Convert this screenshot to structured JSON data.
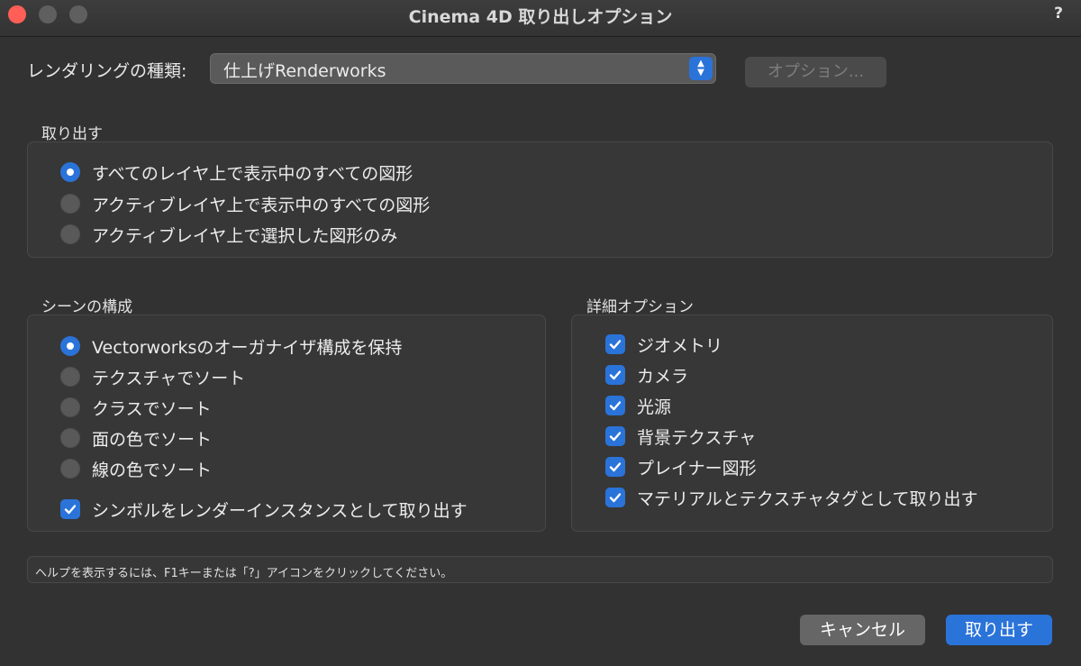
{
  "window": {
    "title": "Cinema 4D 取り出しオプション",
    "help": "?"
  },
  "render": {
    "label": "レンダリングの種類:",
    "selected": "仕上げRenderworks",
    "options_button": "オプション..."
  },
  "export": {
    "title": "取り出す",
    "options": [
      {
        "label": "すべてのレイヤ上で表示中のすべての図形",
        "selected": true
      },
      {
        "label": "アクティブレイヤ上で表示中のすべての図形",
        "selected": false
      },
      {
        "label": "アクティブレイヤ上で選択した図形のみ",
        "selected": false
      }
    ]
  },
  "scene": {
    "title": "シーンの構成",
    "options": [
      {
        "label": "Vectorworksのオーガナイザ構成を保持",
        "selected": true
      },
      {
        "label": "テクスチャでソート",
        "selected": false
      },
      {
        "label": "クラスでソート",
        "selected": false
      },
      {
        "label": "面の色でソート",
        "selected": false
      },
      {
        "label": "線の色でソート",
        "selected": false
      }
    ],
    "symbol_checkbox": {
      "label": "シンボルをレンダーインスタンスとして取り出す",
      "checked": true
    }
  },
  "details": {
    "title": "詳細オプション",
    "checkboxes": [
      {
        "label": "ジオメトリ",
        "checked": true
      },
      {
        "label": "カメラ",
        "checked": true
      },
      {
        "label": "光源",
        "checked": true
      },
      {
        "label": "背景テクスチャ",
        "checked": true
      },
      {
        "label": "プレイナー図形",
        "checked": true
      },
      {
        "label": "マテリアルとテクスチャタグとして取り出す",
        "checked": true
      }
    ]
  },
  "help_text": "ヘルプを表示するには、F1キーまたは「?」アイコンをクリックしてください。",
  "buttons": {
    "cancel": "キャンセル",
    "ok": "取り出す"
  },
  "colors": {
    "accent": "#2a73d9",
    "background": "#323232"
  }
}
